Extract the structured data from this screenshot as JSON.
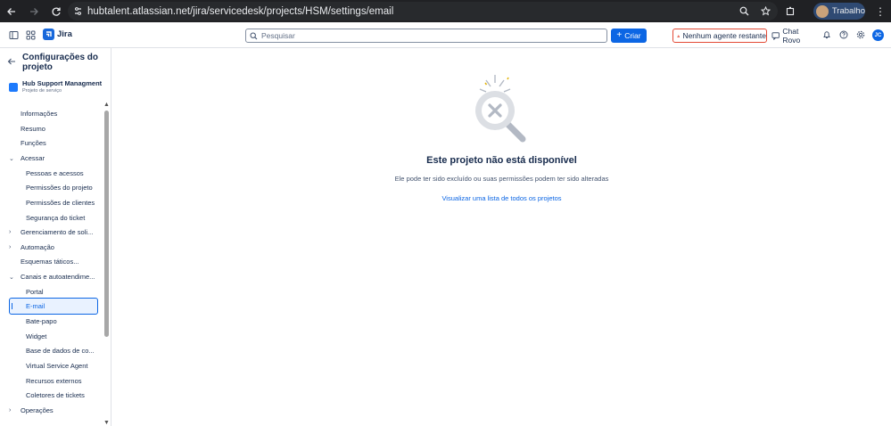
{
  "browser": {
    "url": "hubtalent.atlassian.net/jira/servicedesk/projects/HSM/settings/email",
    "profile_label": "Trabalho"
  },
  "topnav": {
    "app_name": "Jira",
    "search_placeholder": "Pesquisar",
    "create_label": "Criar",
    "agent_warning": "Nenhum agente restante",
    "chat_label": "Chat Rovo",
    "user_initials": "JC"
  },
  "sidebar": {
    "title": "Configurações do projeto",
    "project_name": "Hub Support Managment",
    "project_type": "Projeto de serviço",
    "items": [
      {
        "label": "Informações"
      },
      {
        "label": "Resumo"
      },
      {
        "label": "Funções"
      },
      {
        "label": "Acessar"
      },
      {
        "label": "Pessoas e acessos"
      },
      {
        "label": "Permissões do projeto"
      },
      {
        "label": "Permissões de clientes"
      },
      {
        "label": "Segurança do ticket"
      },
      {
        "label": "Gerenciamento de soli..."
      },
      {
        "label": "Automação"
      },
      {
        "label": "Esquemas táticos..."
      },
      {
        "label": "Canais e autoatendime..."
      },
      {
        "label": "Portal"
      },
      {
        "label": "E-mail"
      },
      {
        "label": "Bate-papo"
      },
      {
        "label": "Widget"
      },
      {
        "label": "Base de dados de co..."
      },
      {
        "label": "Virtual Service Agent"
      },
      {
        "label": "Recursos externos"
      },
      {
        "label": "Coletores de tickets"
      },
      {
        "label": "Operações"
      }
    ]
  },
  "main": {
    "title": "Este projeto não está disponível",
    "description": "Ele pode ter sido excluído ou suas permissões podem ter sido alteradas",
    "link": "Visualizar uma lista de todos os projetos"
  },
  "colors": {
    "accent": "#0c66e4",
    "warning": "#e34935",
    "chrome_dark": "#202124"
  }
}
